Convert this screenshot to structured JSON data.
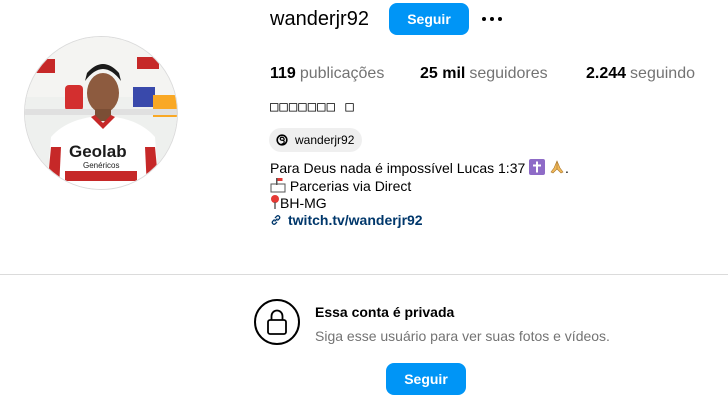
{
  "profile": {
    "username": "wanderjr92",
    "follow_label": "Seguir",
    "full_name": "□□□□□□□ □",
    "avatar": {
      "shirt_text": "Geolab",
      "shirt_subtext": "Genéricos"
    }
  },
  "stats": {
    "posts_count": "119",
    "posts_label": "publicações",
    "followers_count": "25 mil",
    "followers_label": "seguidores",
    "following_count": "2.244",
    "following_label": "seguindo"
  },
  "threads_badge": {
    "label": "wanderjr92",
    "icon": "threads-icon"
  },
  "bio": {
    "line1": "Para Deus nada é impossível Lucas 1:37",
    "line2": "Parcerias via Direct",
    "line3": "BH-MG",
    "link": "twitch.tv/wanderjr92"
  },
  "private": {
    "title": "Essa conta é privada",
    "subtitle": "Siga esse usuário para ver suas fotos e vídeos.",
    "follow_label": "Seguir"
  },
  "colors": {
    "accent": "#0095f6",
    "link": "#00376b",
    "muted": "#737373",
    "divider": "#dbdbdb"
  }
}
